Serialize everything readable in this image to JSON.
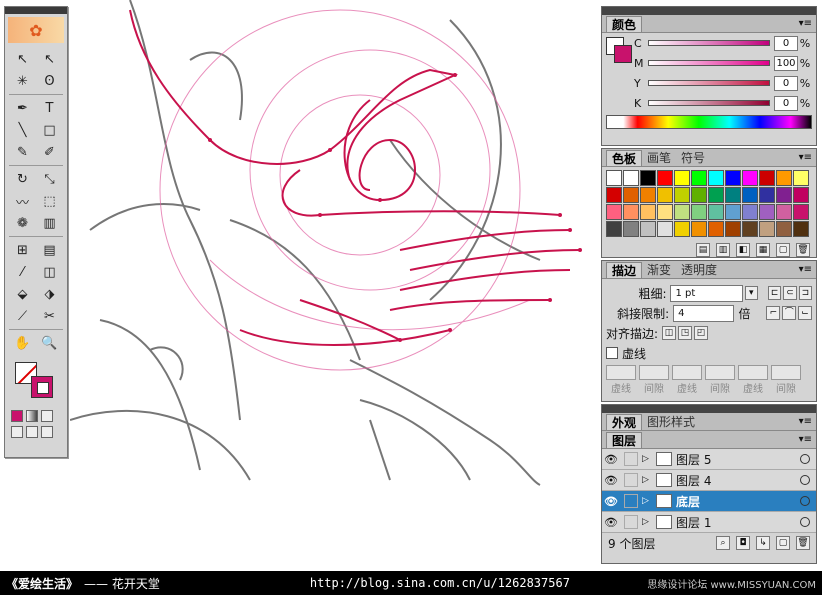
{
  "toolbox": {
    "tools": [
      "selection-icon",
      "direct-selection-icon",
      "magic-wand-icon",
      "lasso-icon",
      "pen-icon",
      "type-icon",
      "line-icon",
      "rectangle-icon",
      "paintbrush-icon",
      "pencil-icon",
      "rotate-icon",
      "scale-icon",
      "warp-icon",
      "free-transform-icon",
      "symbol-sprayer-icon",
      "column-graph-icon",
      "mesh-icon",
      "gradient-icon",
      "eyedropper-icon",
      "blend-icon",
      "live-paint-bucket-icon",
      "live-paint-select-icon",
      "slice-icon",
      "scissors-icon",
      "hand-icon",
      "zoom-icon"
    ],
    "tool_glyphs": [
      "↖",
      "↖",
      "✳",
      "ʘ",
      "✒",
      "T",
      "╲",
      "□",
      "✎",
      "✐",
      "↻",
      "⤡",
      "〰",
      "⬚",
      "❁",
      "▥",
      "⊞",
      "▤",
      "⁄",
      "◫",
      "⬙",
      "⬗",
      "⟋",
      "✂",
      "✋",
      "🔍"
    ]
  },
  "color_panel": {
    "tab": "颜色",
    "channels": [
      {
        "label": "C",
        "value": "0",
        "unit": "%",
        "color": "#c0007c"
      },
      {
        "label": "M",
        "value": "100",
        "unit": "%",
        "color": "#e0008a"
      },
      {
        "label": "Y",
        "value": "0",
        "unit": "%",
        "color": "#c01040"
      },
      {
        "label": "K",
        "value": "0",
        "unit": "%",
        "color": "#900030"
      }
    ]
  },
  "swatches_panel": {
    "tabs": [
      "色板",
      "画笔",
      "符号"
    ],
    "colors": [
      "#ffffff",
      "#ffffff",
      "#000000",
      "#ff0000",
      "#ffff00",
      "#00ff00",
      "#00ffff",
      "#0000ff",
      "#ff00ff",
      "#cc0000",
      "#ff9900",
      "#ffff66",
      "#d40000",
      "#e06000",
      "#f08000",
      "#f0c000",
      "#c0d000",
      "#60b000",
      "#00a050",
      "#008080",
      "#0060c0",
      "#3030a0",
      "#802090",
      "#c00060",
      "#ff6080",
      "#ff9060",
      "#ffc060",
      "#ffe080",
      "#c0e080",
      "#80d080",
      "#60c0a0",
      "#60a0d0",
      "#8080d0",
      "#a060c0",
      "#d060a0",
      "#c8126c",
      "#404040",
      "#808080",
      "#c0c0c0",
      "#e0e0e0",
      "#f0d000",
      "#f09000",
      "#e06000",
      "#a04000",
      "#604020",
      "#c0a080",
      "#906040",
      "#503010"
    ]
  },
  "stroke_panel": {
    "tabs": [
      "描边",
      "渐变",
      "透明度"
    ],
    "weight_label": "粗细:",
    "weight_value": "1 pt",
    "miter_label": "斜接限制:",
    "miter_value": "4",
    "miter_unit": "倍",
    "align_label": "对齐描边:",
    "dashed_label": "虚线",
    "dash_labels": [
      "虚线",
      "间隙",
      "虚线",
      "间隙",
      "虚线",
      "间隙"
    ]
  },
  "appearance_panel": {
    "tabs": [
      "外观",
      "图形样式"
    ]
  },
  "layers_panel": {
    "tab": "图层",
    "layers": [
      {
        "name": "图层 5",
        "selected": false
      },
      {
        "name": "图层 4",
        "selected": false
      },
      {
        "name": "底层",
        "selected": true
      },
      {
        "name": "图层 1",
        "selected": false
      }
    ],
    "count_label": "9 个图层"
  },
  "footer": {
    "title": "《爱绘生活》",
    "author": "—— 花开天堂",
    "url": "http://blog.sina.com.cn/u/1262837567",
    "watermark": "思缘设计论坛 www.MISSYUAN.COM"
  }
}
